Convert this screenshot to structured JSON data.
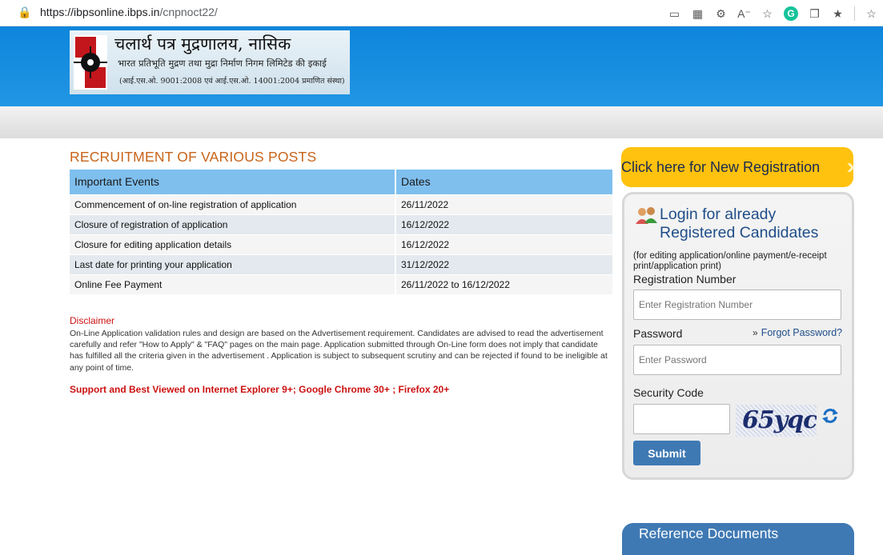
{
  "browser": {
    "url_host": "https://ibpsonline.ibps.in",
    "url_path": "/cnpnoct22/"
  },
  "logo": {
    "line1": "चलार्थ पत्र मुद्रणालय, नासिक",
    "line2": "भारत प्रतिभूति मुद्रण तथा मुद्रा निर्माण निगम लिमिटेड की इकाई",
    "line3": "(आई.एस.ओ. 9001:2008 एवं आई.एस.ओ. 14001:2004 प्रमाणित संस्था)"
  },
  "main": {
    "title": "RECRUITMENT OF VARIOUS POSTS",
    "table": {
      "headers": [
        "Important Events",
        "Dates"
      ],
      "rows": [
        [
          "Commencement of on-line registration of application",
          "26/11/2022"
        ],
        [
          "Closure of registration of application",
          "16/12/2022"
        ],
        [
          "Closure for editing application details",
          "16/12/2022"
        ],
        [
          "Last date for printing your application",
          "31/12/2022"
        ],
        [
          "Online Fee Payment",
          "26/11/2022 to 16/12/2022"
        ]
      ]
    },
    "disclaimer_heading": "Disclaimer",
    "disclaimer_text": "On-Line Application validation rules and design are based on the Advertisement requirement. Candidates are advised to read the advertisement carefully and refer \"How to Apply\" & \"FAQ\" pages on the main page. Application submitted through On-Line form does not imply that candidate has fulfilled all the criteria given in the advertisement . Application is subject to subsequent scrutiny and can be rejected if found to be ineligible at any point of time.",
    "support_text": "Support and Best Viewed on Internet Explorer 9+; Google Chrome 30+ ; Firefox 20+"
  },
  "sidebar": {
    "new_registration": "Click here for New Registration",
    "login": {
      "heading_line1": "Login for already",
      "heading_line2": "Registered Candidates",
      "subtext": "(for editing application/online payment/e-receipt print/application print)",
      "reg_label": "Registration Number",
      "reg_placeholder": "Enter Registration Number",
      "password_label": "Password",
      "forgot_link": "Forgot Password?",
      "password_placeholder": "Enter Password",
      "security_label": "Security Code",
      "captcha_text": "65yqc",
      "submit_label": "Submit"
    },
    "reference_docs": "Reference Documents"
  },
  "colors": {
    "header_blue": "#1a8fe0",
    "title_orange": "#c8641b",
    "registration_yellow": "#ffc20e",
    "button_blue": "#3f79b4",
    "alert_red": "#cc1111"
  }
}
